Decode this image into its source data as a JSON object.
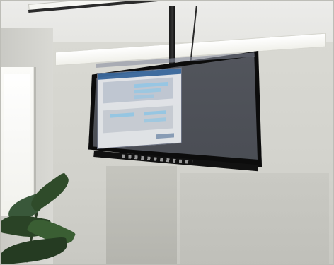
{
  "scene": {
    "type": "photo",
    "subject": "wall-mounted-tv",
    "tv": {
      "screen": {
        "has_window": true,
        "has_taskbar": true
      }
    }
  },
  "colors": {
    "tv_frame": "#0c0c0c",
    "tv_screen": "#4a4d54",
    "window_title": "#3f6fa6",
    "field_highlight": "#9fd3f2",
    "plant": "#2f4b2a"
  }
}
